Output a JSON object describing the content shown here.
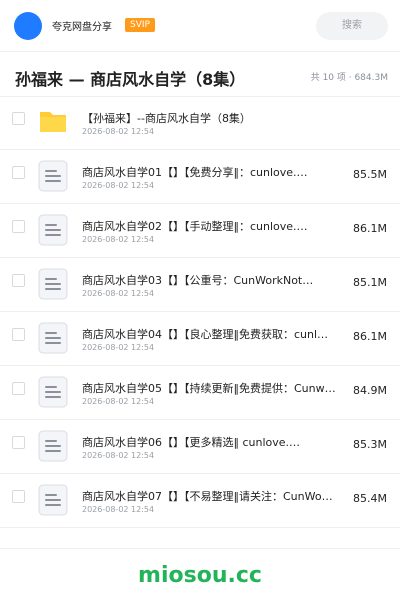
{
  "header": {
    "brand": "夸克网盘分享",
    "badge": "SVIP",
    "search_placeholder": "搜索"
  },
  "share": {
    "title": "孙福来 — 商店风水自学（8集）",
    "meta": "共 10 项 · 684.3M"
  },
  "items": [
    {
      "type": "folder",
      "name": "【孙福来】--商店风水自学（8集）",
      "time": "2026-08-02 12:54",
      "size": ""
    },
    {
      "type": "file",
      "name": "商店风水自学01【】【免费分享‖：cunlove.…",
      "time": "2026-08-02 12:54",
      "size": "85.5M"
    },
    {
      "type": "file",
      "name": "商店风水自学02【】【手动整理‖：cunlove.…",
      "time": "2026-08-02 12:54",
      "size": "86.1M"
    },
    {
      "type": "file",
      "name": "商店风水自学03【】【公重号：CunWorkNot…",
      "time": "2026-08-02 12:54",
      "size": "85.1M"
    },
    {
      "type": "file",
      "name": "商店风水自学04【】【良心整理‖免费获取：cunl…",
      "time": "2026-08-02 12:54",
      "size": "86.1M"
    },
    {
      "type": "file",
      "name": "商店风水自学05【】【持续更新‖免费提供：Cunw…",
      "time": "2026-08-02 12:54",
      "size": "84.9M"
    },
    {
      "type": "file",
      "name": "商店风水自学06【】【更多精选‖ cunlove.…",
      "time": "2026-08-02 12:54",
      "size": "85.3M"
    },
    {
      "type": "file",
      "name": "商店风水自学07【】【不易整理‖请关注：CunWo…",
      "time": "2026-08-02 12:54",
      "size": "85.4M"
    }
  ],
  "footer": {
    "watermark": "miosou.cc"
  },
  "colors": {
    "accent": "#1f7bff",
    "svip": "#ff9b1a",
    "folder": "#ffd23a",
    "watermark": "#23b45a"
  }
}
